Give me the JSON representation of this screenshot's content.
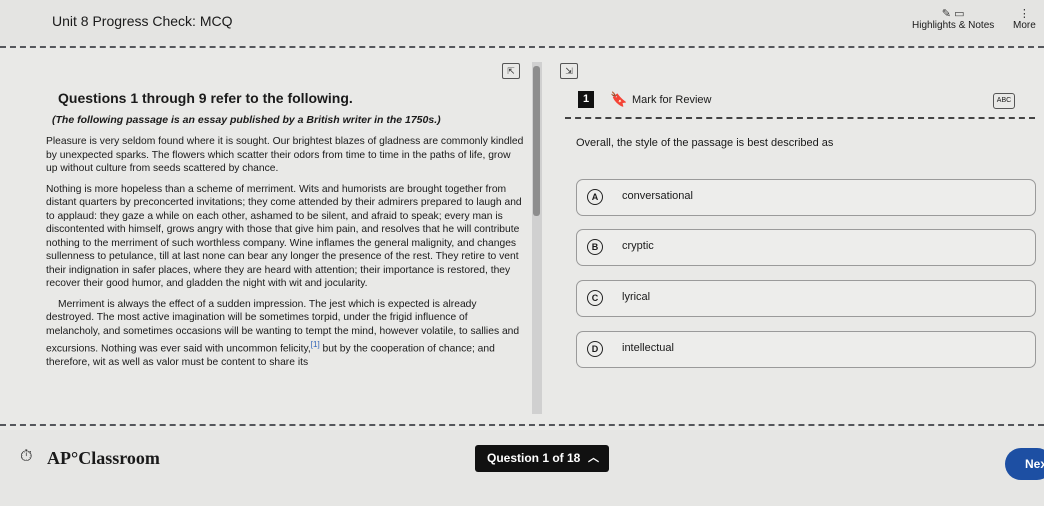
{
  "header": {
    "title": "Unit 8 Progress Check: MCQ",
    "tools": [
      {
        "label": "Highlights & Notes",
        "icon": "highlighter-icon"
      },
      {
        "label": "More",
        "icon": "more-vertical-icon"
      }
    ]
  },
  "passage": {
    "heading": "Questions 1 through 9 refer to the following.",
    "intro": "(The following passage is an essay published by a British writer in the 1750s.)",
    "paragraphs": [
      "Pleasure is very seldom found where it is sought. Our brightest blazes of gladness are commonly kindled by unexpected sparks. The flowers which scatter their odors from time to time in the paths of life, grow up without culture from seeds scattered by chance.",
      "Nothing is more hopeless than a scheme of merriment. Wits and humorists are brought together from distant quarters by preconcerted invitations; they come attended by their admirers prepared to laugh and to applaud: they gaze a while on each other, ashamed to be silent, and afraid to speak; every man is discontented with himself, grows angry with those that give him pain, and resolves that he will contribute nothing to the merriment of such worthless company. Wine inflames the general malignity, and changes sullenness to petulance, till at last none can bear any longer the presence of the rest. They retire to vent their indignation in safer places, where they are heard with attention; their importance is restored, they recover their good humor, and gladden the night with wit and jocularity.",
      "Merriment is always the effect of a sudden impression. The jest which is expected is already destroyed. The most active imagination will be sometimes torpid, under the frigid influence of melancholy, and sometimes occasions will be wanting to tempt the mind, however volatile, to sallies and excursions. Nothing was ever said with uncommon felicity,",
      " but by the cooperation of chance; and therefore, wit as well as valor must be content to share its"
    ],
    "footnote_marker": "[1]"
  },
  "question": {
    "number": "1",
    "mark_label": "Mark for Review",
    "abc_label": "ABC",
    "stem": "Overall, the style of the passage is best described as",
    "options": [
      {
        "letter": "A",
        "text": "conversational"
      },
      {
        "letter": "B",
        "text": "cryptic"
      },
      {
        "letter": "C",
        "text": "lyrical"
      },
      {
        "letter": "D",
        "text": "intellectual"
      }
    ]
  },
  "footer": {
    "brand": "AP°Classroom",
    "question_nav": "Question 1 of 18",
    "next_label": "Next"
  }
}
